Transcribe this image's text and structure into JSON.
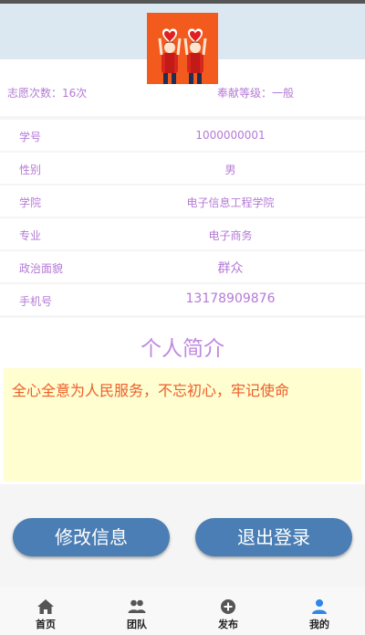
{
  "profile": {
    "volunteer_count": "志愿次数：16次",
    "contribution_level": "奉献等级：一般"
  },
  "info_rows": [
    {
      "label": "学号",
      "value": "1000000001"
    },
    {
      "label": "性别",
      "value": "男"
    },
    {
      "label": "学院",
      "value": "电子信息工程学院"
    },
    {
      "label": "专业",
      "value": "电子商务"
    },
    {
      "label": "政治面貌",
      "value": "群众"
    },
    {
      "label": "手机号",
      "value": "13178909876"
    }
  ],
  "intro": {
    "title": "个人简介",
    "text": "全心全意为人民服务，不忘初心，牢记使命"
  },
  "actions": {
    "edit_label": "修改信息",
    "logout_label": "退出登录"
  },
  "nav": {
    "items": [
      {
        "label": "首页",
        "icon": "home-icon"
      },
      {
        "label": "团队",
        "icon": "team-icon"
      },
      {
        "label": "发布",
        "icon": "add-circle-icon"
      },
      {
        "label": "我的",
        "icon": "person-icon"
      }
    ],
    "active_color": "#2f86e6",
    "inactive_color": "#555555"
  },
  "colors": {
    "label": "#b57ad6",
    "button": "#4a7eb4",
    "intro_text": "#ef5d2b",
    "intro_bg": "#fefed0"
  }
}
